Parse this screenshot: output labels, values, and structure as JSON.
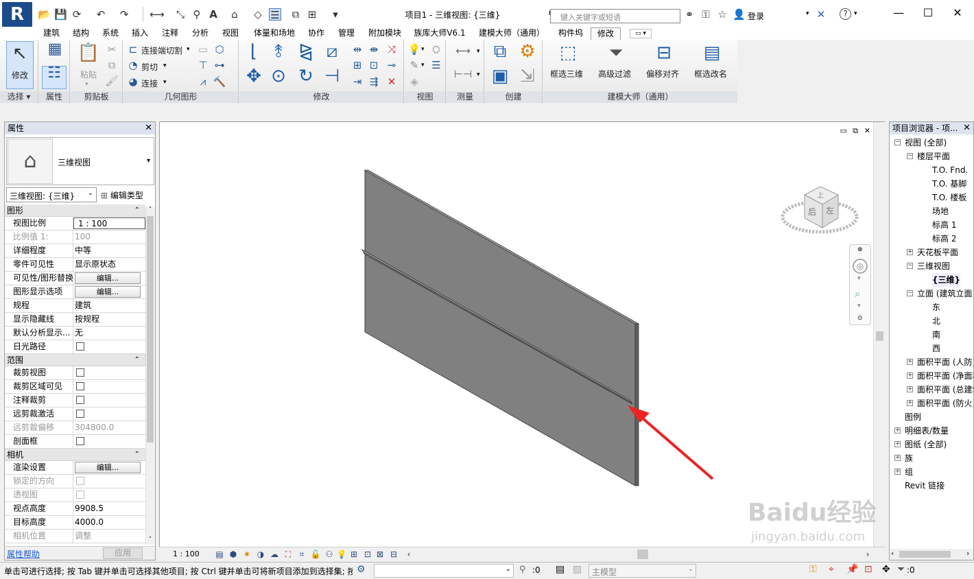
{
  "app": {
    "title": "项目1 - 三维视图: {三维}",
    "logo": "R",
    "search_placeholder": "键入关键字或短语",
    "login": "登录"
  },
  "tabs": [
    "建筑",
    "结构",
    "系统",
    "插入",
    "注释",
    "分析",
    "视图",
    "体量和场地",
    "协作",
    "管理",
    "附加模块",
    "族库大师V6.1",
    "建模大师（通用）",
    "构件坞",
    "修改"
  ],
  "ribbon": {
    "select": {
      "modify": "修改",
      "title": "选择"
    },
    "props": {
      "title": "属性"
    },
    "clipboard": {
      "paste": "粘贴",
      "title": "剪贴板"
    },
    "geometry": {
      "cut_join": "连接端切割",
      "cut": "剪切",
      "join": "连接",
      "title": "几何图形"
    },
    "modify": {
      "title": "修改"
    },
    "view": {
      "title": "视图"
    },
    "measure": {
      "title": "测量"
    },
    "create": {
      "title": "创建"
    },
    "master": {
      "b1": "框选三维",
      "b2": "高级过滤",
      "b3": "偏移对齐",
      "b4": "框选改名",
      "title": "建模大师（通用）"
    }
  },
  "properties": {
    "header": "属性",
    "type_name": "三维视图",
    "view_selector": "三维视图: {三维}",
    "edit_type": "编辑类型",
    "groups": [
      {
        "name": "图形",
        "rows": [
          {
            "label": "视图比例",
            "value": "1 : 100",
            "kind": "input"
          },
          {
            "label": "比例值 1:",
            "value": "100",
            "kind": "text",
            "disabled": true
          },
          {
            "label": "详细程度",
            "value": "中等",
            "kind": "text"
          },
          {
            "label": "零件可见性",
            "value": "显示原状态",
            "kind": "text"
          },
          {
            "label": "可见性/图形替换",
            "value": "编辑...",
            "kind": "button"
          },
          {
            "label": "图形显示选项",
            "value": "编辑...",
            "kind": "button"
          },
          {
            "label": "规程",
            "value": "建筑",
            "kind": "text"
          },
          {
            "label": "显示隐藏线",
            "value": "按规程",
            "kind": "text"
          },
          {
            "label": "默认分析显示...",
            "value": "无",
            "kind": "text"
          },
          {
            "label": "日光路径",
            "value": "",
            "kind": "check"
          }
        ]
      },
      {
        "name": "范围",
        "rows": [
          {
            "label": "裁剪视图",
            "value": "",
            "kind": "check"
          },
          {
            "label": "裁剪区域可见",
            "value": "",
            "kind": "check"
          },
          {
            "label": "注释裁剪",
            "value": "",
            "kind": "check"
          },
          {
            "label": "远剪裁激活",
            "value": "",
            "kind": "check"
          },
          {
            "label": "远剪裁偏移",
            "value": "304800.0",
            "kind": "text",
            "disabled": true
          },
          {
            "label": "剖面框",
            "value": "",
            "kind": "check"
          }
        ]
      },
      {
        "name": "相机",
        "rows": [
          {
            "label": "渲染设置",
            "value": "编辑...",
            "kind": "button"
          },
          {
            "label": "锁定的方向",
            "value": "",
            "kind": "check",
            "disabled": true
          },
          {
            "label": "透视图",
            "value": "",
            "kind": "check",
            "disabled": true
          },
          {
            "label": "视点高度",
            "value": "9908.5",
            "kind": "text"
          },
          {
            "label": "目标高度",
            "value": "4000.0",
            "kind": "text"
          },
          {
            "label": "相机位置",
            "value": "调整",
            "kind": "text",
            "disabled": true
          }
        ]
      }
    ],
    "help": "属性帮助",
    "apply": "应用"
  },
  "browser": {
    "header": "项目浏览器 - 项...",
    "nodes": [
      {
        "t": "视图 (全部)",
        "lv": 0,
        "tog": "-"
      },
      {
        "t": "楼层平面",
        "lv": 1,
        "tog": "-"
      },
      {
        "t": "T.O. Fnd.",
        "lv": 2
      },
      {
        "t": "T.O. 基脚",
        "lv": 2
      },
      {
        "t": "T.O. 楼板",
        "lv": 2
      },
      {
        "t": "场地",
        "lv": 2
      },
      {
        "t": "标高 1",
        "lv": 2
      },
      {
        "t": "标高 2",
        "lv": 2
      },
      {
        "t": "天花板平面",
        "lv": 1,
        "tog": "+"
      },
      {
        "t": "三维视图",
        "lv": 1,
        "tog": "-"
      },
      {
        "t": "{三维}",
        "lv": 2,
        "bold": true
      },
      {
        "t": "立面 (建筑立面)",
        "lv": 1,
        "tog": "-"
      },
      {
        "t": "东",
        "lv": 2
      },
      {
        "t": "北",
        "lv": 2
      },
      {
        "t": "南",
        "lv": 2
      },
      {
        "t": "西",
        "lv": 2
      },
      {
        "t": "面积平面 (人防)",
        "lv": 1,
        "tog": "+"
      },
      {
        "t": "面积平面 (净面积)",
        "lv": 1,
        "tog": "+"
      },
      {
        "t": "面积平面 (总建筑面积)",
        "lv": 1,
        "tog": "+"
      },
      {
        "t": "面积平面 (防火)",
        "lv": 1,
        "tog": "+"
      },
      {
        "t": "图例",
        "lv": 0
      },
      {
        "t": "明细表/数量",
        "lv": 0,
        "tog": "+"
      },
      {
        "t": "图纸 (全部)",
        "lv": 0,
        "tog": "+"
      },
      {
        "t": "族",
        "lv": 0,
        "tog": "+"
      },
      {
        "t": "组",
        "lv": 0,
        "tog": "+"
      },
      {
        "t": "Revit 链接",
        "lv": 0
      }
    ]
  },
  "viewcube": {
    "left": "左",
    "front": "后",
    "top": "上"
  },
  "viewctrl": {
    "scale": "1 : 100"
  },
  "status": {
    "message": "单击可进行选择; 按 Tab 键并单击可选择其他项目; 按 Ctrl 键并单击可将新项目添加到选择集; 按",
    "zero": ":0",
    "model": "主模型",
    "filter": ":0"
  },
  "watermark": {
    "brand": "Baidu经验",
    "url": "jingyan.baidu.com"
  },
  "colors": {
    "ribbon_tab_active": "#fafafa",
    "panel_title": "#dfe3e8",
    "wall": "#808080",
    "arrow": "#ee2222"
  }
}
